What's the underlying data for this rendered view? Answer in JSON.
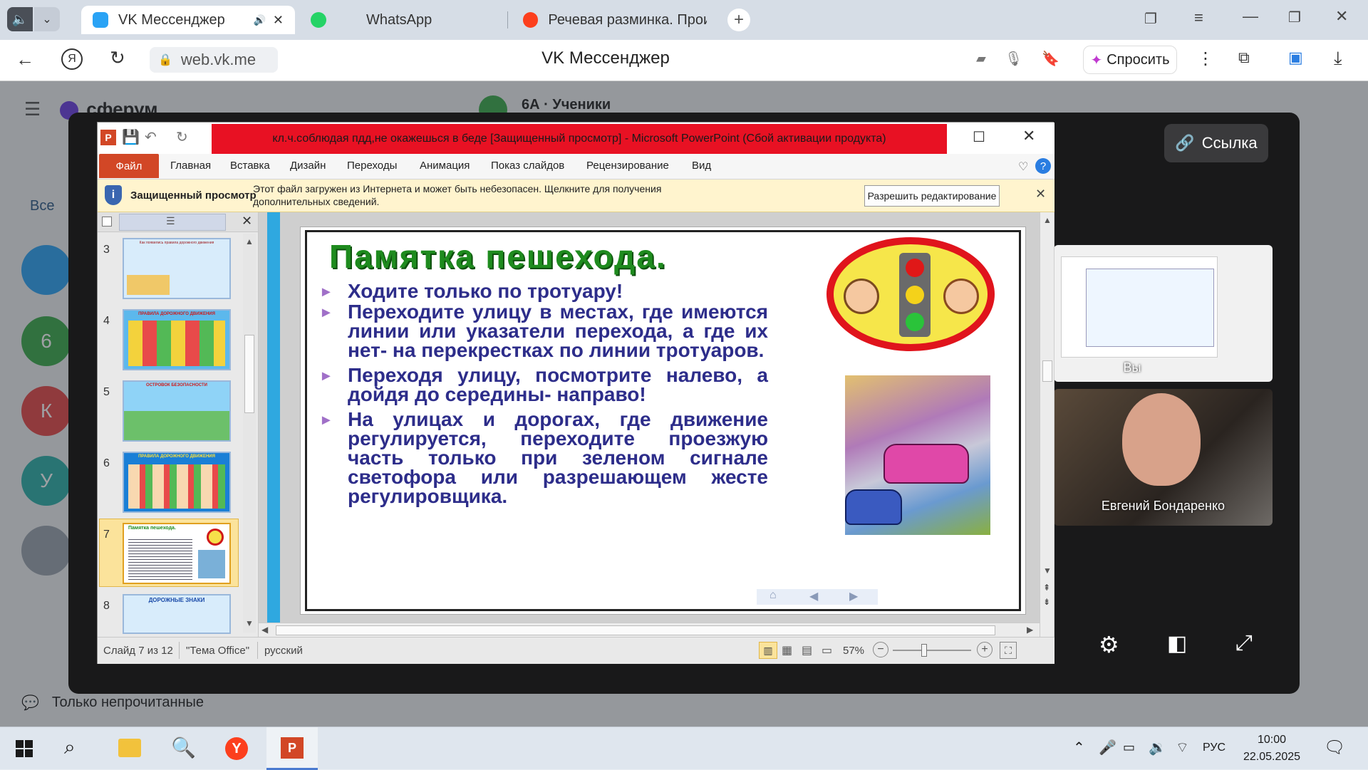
{
  "browser": {
    "tabs": [
      {
        "label": "VK Мессенджер",
        "active": true
      },
      {
        "label": "WhatsApp",
        "active": false
      },
      {
        "label": "Речевая разминка. Прои",
        "active": false
      }
    ],
    "address": "web.vk.me",
    "page_title": "VK Мессенджер",
    "ask_label": "Спросить"
  },
  "vk": {
    "brand": "сферум",
    "chat_title": "6А · Ученики",
    "filter_all": "Все",
    "unread_only": "Только непрочитанные",
    "avatars": [
      "6",
      "К",
      "У"
    ],
    "link_button": "Ссылка"
  },
  "call": {
    "you_label": "Вы",
    "participant_name": "Евгений Бондаренко"
  },
  "ppt": {
    "title": "кл.ч.соблюдая  пдд,не окажешься в беде [Защищенный просмотр]  -  Microsoft PowerPoint (Сбой активации продукта)",
    "file_tab": "Файл",
    "ribbon_tabs": [
      "Главная",
      "Вставка",
      "Дизайн",
      "Переходы",
      "Анимация",
      "Показ слайдов",
      "Рецензирование",
      "Вид"
    ],
    "protected_title": "Защищенный просмотр",
    "protected_msg": "Этот файл загружен из Интернета и может быть небезопасен. Щелкните для получения дополнительных сведений.",
    "enable_editing": "Разрешить редактирование",
    "thumb_numbers": [
      "3",
      "4",
      "5",
      "6",
      "7",
      "8"
    ],
    "selected_thumb": "7",
    "thumb_captions": {
      "t3": "Как появились правила дорожного движения",
      "t4": "ПРАВИЛА ДОРОЖНОГО ДВИЖЕНИЯ",
      "t5": "ОСТРОВОК БЕЗОПАСНОСТИ",
      "t6": "ПРАВИЛА ДОРОЖНОГО ДВИЖЕНИЯ",
      "t7": "Памятка пешехода.",
      "t8": "ДОРОЖНЫЕ ЗНАКИ"
    },
    "status": {
      "slide": "Слайд 7 из 12",
      "theme": "\"Тема Office\"",
      "lang": "русский",
      "zoom": "57%"
    },
    "slide": {
      "heading": "Памятка пешехода.",
      "bullets": [
        "Ходите только по тротуару!",
        "Переходите улицу в местах, где имеются линии или указатели перехода, а где их нет- на перекрестках по линии тротуаров.",
        "Переходя улицу, посмотрите налево, а дойдя до середины- направо!",
        "На улицах и дорогах, где движение регулируется, переходите проезжую часть только при зеленом сигнале светофора или разрешающем жесте регулировщика."
      ]
    }
  },
  "taskbar": {
    "lang": "РУС",
    "time": "10:00",
    "date": "22.05.2025"
  },
  "colors": {
    "ppt_red": "#e81123",
    "ppt_file": "#d24726",
    "slide_green": "#1e8b1e",
    "slide_text": "#2d2d8a",
    "bullet": "#a070c8"
  }
}
